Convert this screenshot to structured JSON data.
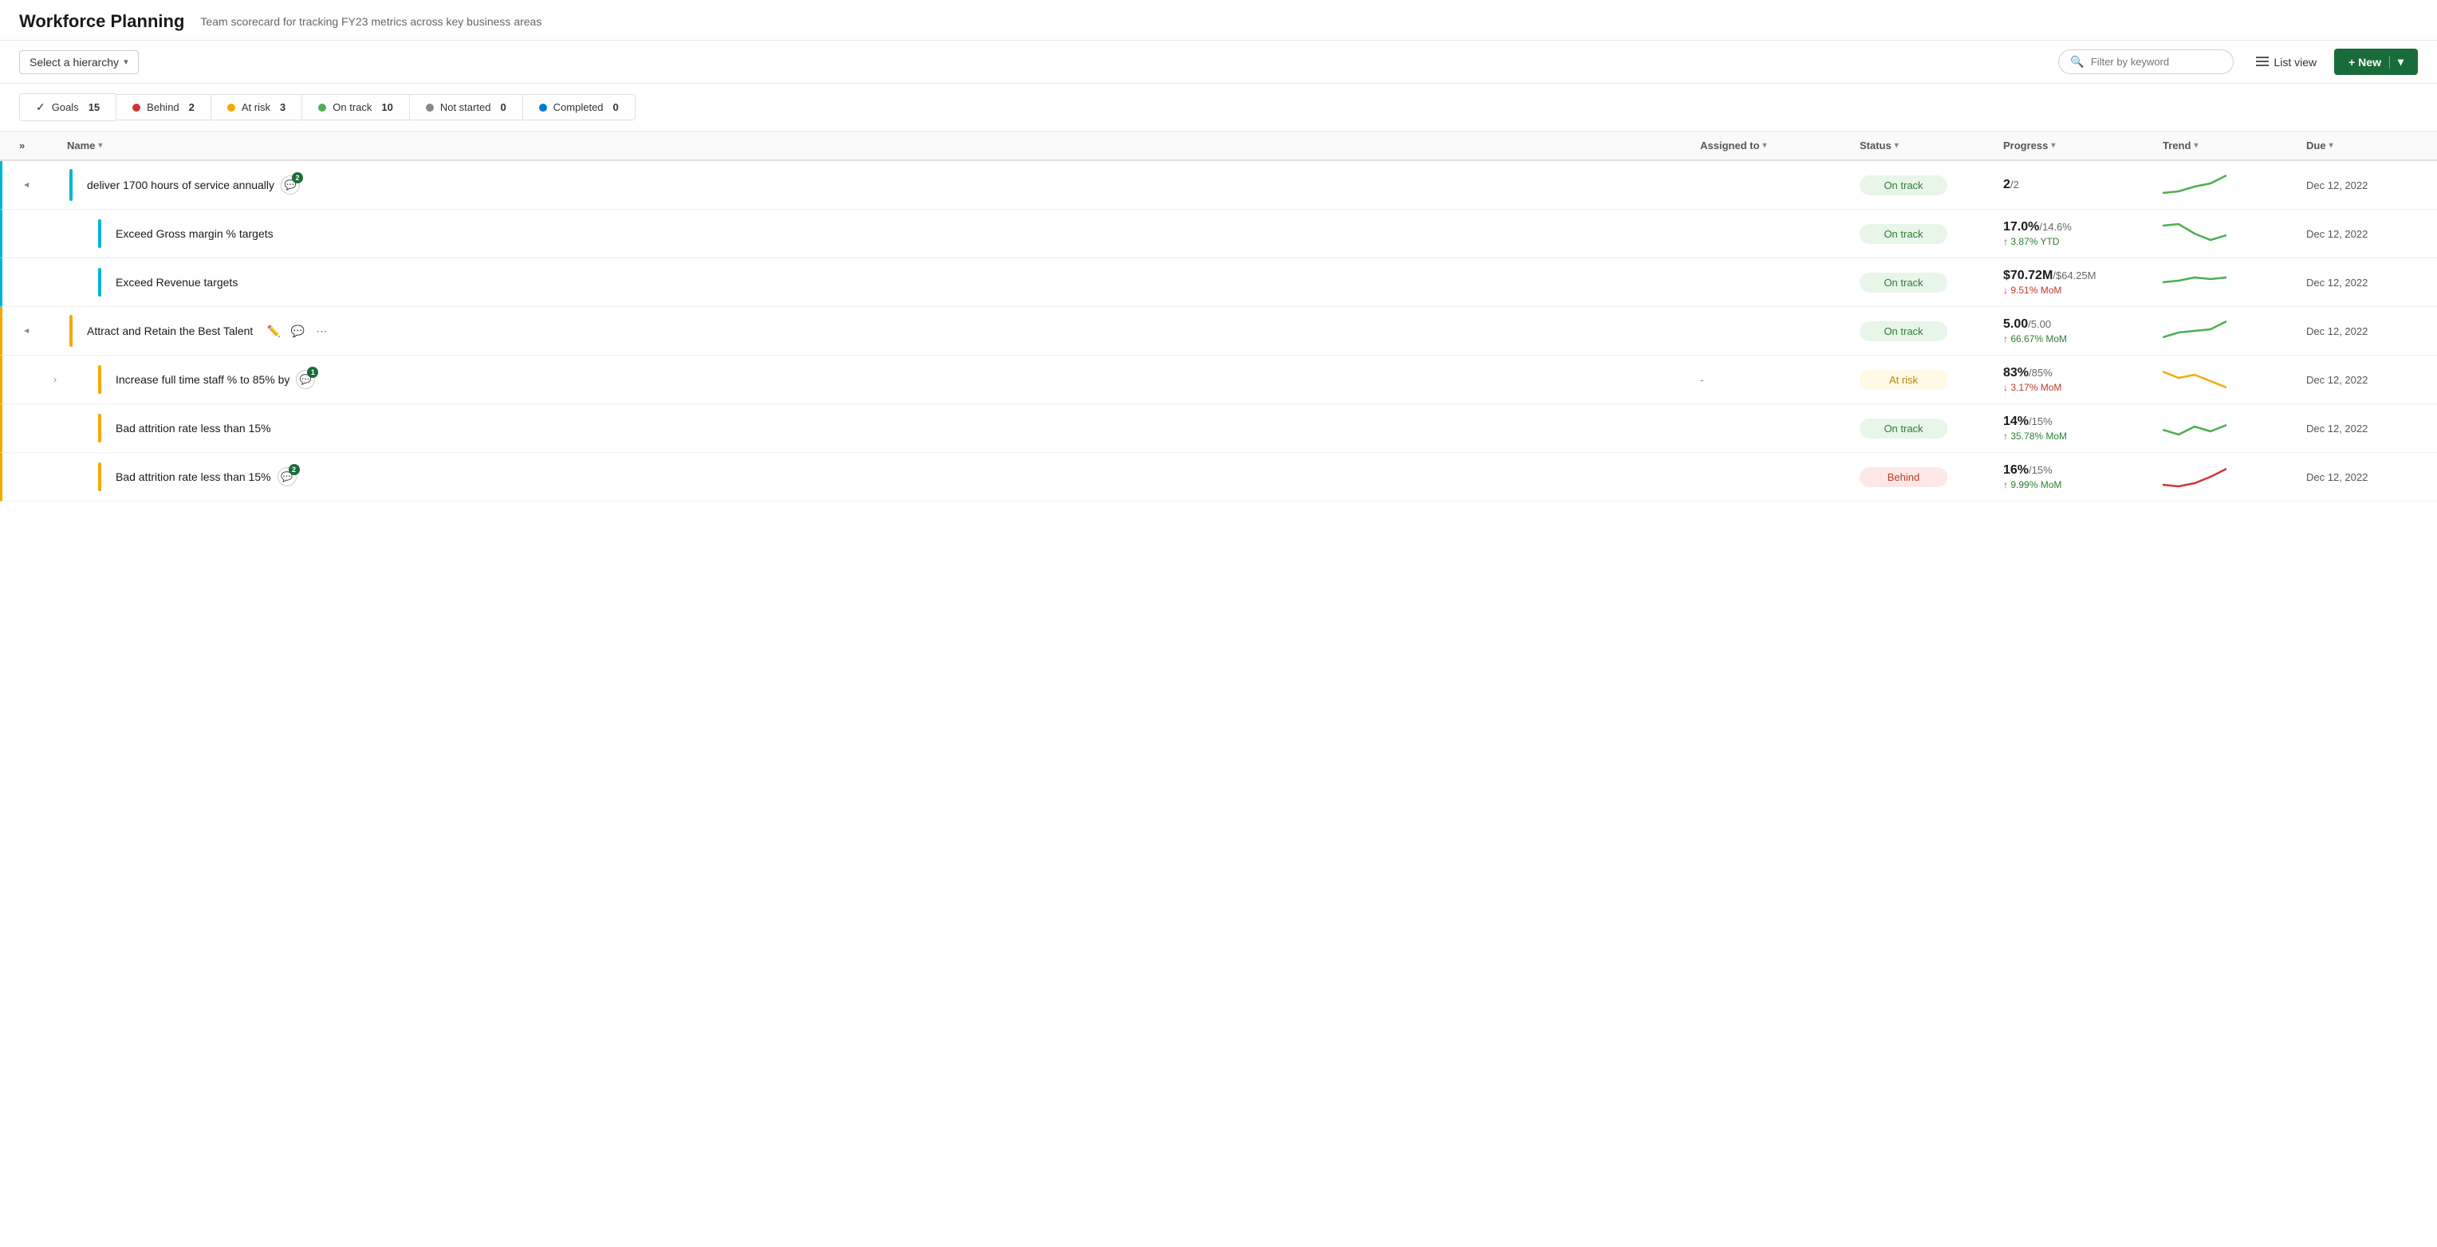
{
  "header": {
    "title": "Workforce Planning",
    "subtitle": "Team scorecard for tracking FY23 metrics across key business areas"
  },
  "toolbar": {
    "hierarchy_label": "Select a hierarchy",
    "hierarchy_chevron": "▾",
    "filter_placeholder": "Filter by keyword",
    "list_view_label": "List view",
    "new_label": "+ New",
    "new_chevron": "▾"
  },
  "status_bar": {
    "goals_label": "Goals",
    "goals_count": "15",
    "behind_label": "Behind",
    "behind_count": "2",
    "at_risk_label": "At risk",
    "at_risk_count": "3",
    "on_track_label": "On track",
    "on_track_count": "10",
    "not_started_label": "Not started",
    "not_started_count": "0",
    "completed_label": "Completed",
    "completed_count": "0"
  },
  "table": {
    "columns": {
      "expand": "",
      "name": "Name",
      "assigned_to": "Assigned to",
      "status": "Status",
      "progress": "Progress",
      "trend": "Trend",
      "due": "Due"
    },
    "rows": [
      {
        "id": 1,
        "level": 0,
        "color": "cyan",
        "expandable": true,
        "expanded": true,
        "name": "deliver 1700 hours of service annually",
        "comment_count": "2",
        "assigned_to": "",
        "status": "On track",
        "status_type": "on-track",
        "progress_main": "2",
        "progress_target": "/2",
        "progress_sub": "",
        "progress_sub_type": "",
        "trend_type": "green-up",
        "due": "Dec 12, 2022"
      },
      {
        "id": 2,
        "level": 1,
        "color": "cyan",
        "expandable": false,
        "expanded": false,
        "name": "Exceed Gross margin % targets",
        "comment_count": null,
        "assigned_to": "",
        "status": "On track",
        "status_type": "on-track",
        "progress_main": "17.0%",
        "progress_target": "/14.6%",
        "progress_sub": "↑ 3.87% YTD",
        "progress_sub_type": "up",
        "trend_type": "green-down",
        "due": "Dec 12, 2022"
      },
      {
        "id": 3,
        "level": 1,
        "color": "cyan",
        "expandable": false,
        "expanded": false,
        "name": "Exceed Revenue targets",
        "comment_count": null,
        "assigned_to": "",
        "status": "On track",
        "status_type": "on-track",
        "progress_main": "$70.72M",
        "progress_target": "/$64.25M",
        "progress_sub": "↓ 9.51% MoM",
        "progress_sub_type": "down",
        "trend_type": "green-flat",
        "due": "Dec 12, 2022"
      },
      {
        "id": 4,
        "level": 0,
        "color": "orange",
        "expandable": true,
        "expanded": true,
        "name": "Attract and Retain the Best Talent",
        "comment_count": null,
        "show_actions": true,
        "assigned_to": "",
        "status": "On track",
        "status_type": "on-track",
        "progress_main": "5.00",
        "progress_target": "/5.00",
        "progress_sub": "↑ 66.67% MoM",
        "progress_sub_type": "up",
        "trend_type": "green-up2",
        "due": "Dec 12, 2022"
      },
      {
        "id": 5,
        "level": 1,
        "color": "orange",
        "expandable": true,
        "expanded": false,
        "name": "Increase full time staff % to 85% by",
        "comment_count": "1",
        "assigned_to": "-",
        "status": "At risk",
        "status_type": "at-risk",
        "progress_main": "83%",
        "progress_target": "/85%",
        "progress_sub": "↓ 3.17% MoM",
        "progress_sub_type": "down",
        "trend_type": "yellow-down",
        "due": "Dec 12, 2022"
      },
      {
        "id": 6,
        "level": 1,
        "color": "orange",
        "expandable": false,
        "expanded": false,
        "name": "Bad attrition rate less than 15%",
        "comment_count": null,
        "assigned_to": "",
        "status": "On track",
        "status_type": "on-track",
        "progress_main": "14%",
        "progress_target": "/15%",
        "progress_sub": "↑ 35.78% MoM",
        "progress_sub_type": "up",
        "trend_type": "green-wavy",
        "due": "Dec 12, 2022"
      },
      {
        "id": 7,
        "level": 1,
        "color": "orange",
        "expandable": false,
        "expanded": false,
        "name": "Bad attrition rate less than 15%",
        "comment_count": "2",
        "assigned_to": "",
        "status": "Behind",
        "status_type": "behind",
        "progress_main": "16%",
        "progress_target": "/15%",
        "progress_sub": "↑ 9.99% MoM",
        "progress_sub_type": "up",
        "trend_type": "red-up",
        "due": "Dec 12, 2022"
      }
    ]
  }
}
